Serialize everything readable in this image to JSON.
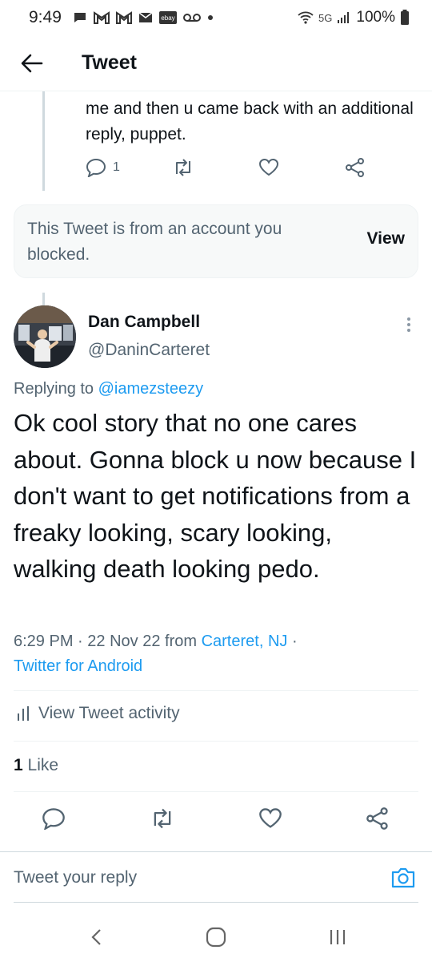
{
  "status_bar": {
    "time": "9:49",
    "network": "5G",
    "battery": "100%",
    "notification_icons": [
      "message-icon",
      "gmail-icon",
      "gmail-icon",
      "mail-icon",
      "ebay-icon",
      "voicemail-icon",
      "dot-icon"
    ]
  },
  "header": {
    "title": "Tweet"
  },
  "previous_tweet": {
    "text": "me and then u came back with an additional reply, puppet.",
    "reply_count": "1"
  },
  "blocked_notice": {
    "text": "This Tweet is from an account you blocked.",
    "action": "View"
  },
  "tweet": {
    "author_name": "Dan Campbell",
    "author_handle": "@DaninCarteret",
    "replying_prefix": "Replying to",
    "replying_to": "@iamezsteezy",
    "body": "Ok cool story that no one cares about. Gonna block u now because I don't want to get notifications from a freaky looking, scary looking, walking death looking pedo.",
    "time": "6:29 PM",
    "date": "22 Nov 22",
    "from_label": "from",
    "location": "Carteret, NJ",
    "source": "Twitter for Android",
    "activity_label": "View Tweet activity",
    "like_count": "1",
    "like_label": "Like"
  },
  "reply_bar": {
    "placeholder": "Tweet your reply"
  },
  "colors": {
    "accent": "#1d9bf0",
    "text": "#0f1419",
    "secondary": "#536471",
    "border": "#eff3f4"
  }
}
